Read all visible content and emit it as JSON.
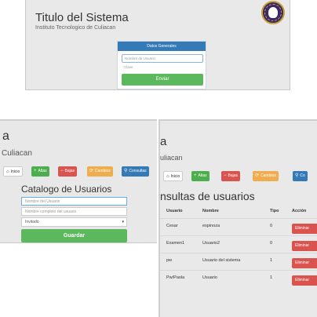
{
  "panel_login": {
    "title": "Titulo del Sistema",
    "subtitle": "Instituto Tecnologico de Culiacan",
    "form_header": "Datos Generales",
    "username_placeholder": "Nombre de Usuario",
    "password_placeholder": "Clave",
    "submit_label": "Enviar"
  },
  "panel_alta": {
    "title_fragment": "a",
    "subtitle_fragment": "Culiacan",
    "nav": {
      "inicio": "Inicio",
      "altas": "Altas",
      "bajas": "Bajas",
      "cambios": "Cambios",
      "consultas": "Consultas"
    },
    "heading": "Catalogo de Usuarios",
    "username_placeholder": "Nombre del Usuario",
    "fullname_placeholder": "Nombre completo del usuario",
    "type_selected": "Invitado",
    "save_label": "Guardar"
  },
  "panel_consultas": {
    "title_fragment": "a",
    "subtitle_fragment": "uliacan",
    "nav": {
      "inicio": "Inicio",
      "altas": "Altas",
      "bajas": "Bajas",
      "cambios": "Cambios",
      "consultas": "Co"
    },
    "heading": "nsultas de usuarios",
    "columns": [
      "Usuario",
      "Nombre",
      "Tipo",
      "Acción"
    ],
    "rows": [
      {
        "usuario": "Cesar",
        "nombre": "espinoza",
        "tipo": "0",
        "accion": "Eliminar"
      },
      {
        "usuario": "Examen1",
        "nombre": "Usuario2",
        "tipo": "0",
        "accion": "Eliminar"
      },
      {
        "usuario": "pw",
        "nombre": "Usuario del sistema",
        "tipo": "1",
        "accion": "Eliminar"
      },
      {
        "usuario": "Pw/Paola",
        "nombre": "Usuario",
        "tipo": "1",
        "accion": "Eliminar"
      }
    ]
  },
  "colors": {
    "primary": "#337ab7",
    "success": "#5cb85c",
    "danger": "#d9534f",
    "warning": "#f0ad4e",
    "background": "#e9e9e9"
  },
  "icons": {
    "inicio": "home-icon",
    "altas": "plus-icon",
    "bajas": "minus-icon",
    "cambios": "refresh-icon",
    "consultas": "search-icon"
  }
}
